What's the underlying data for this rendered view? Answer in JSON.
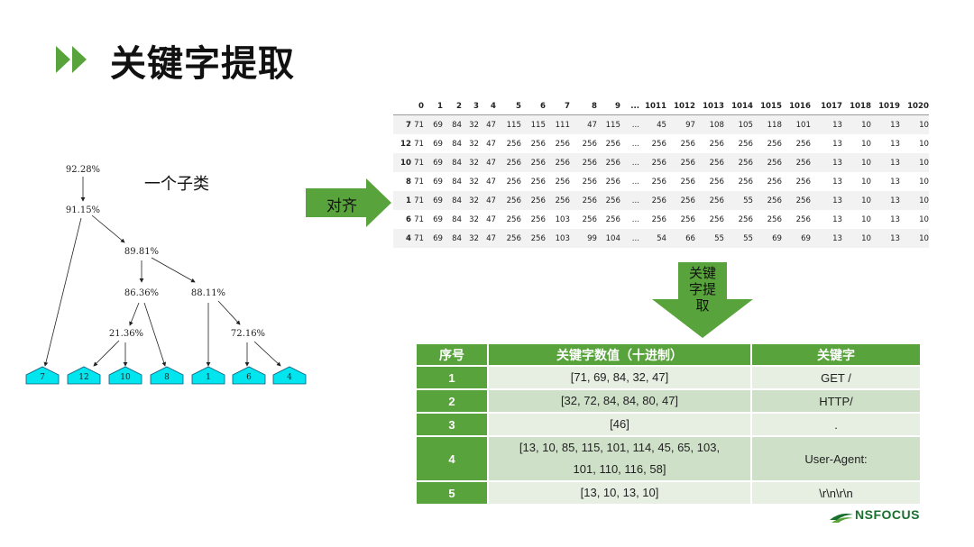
{
  "title": "关键字提取",
  "colors": {
    "accent": "#58a33b",
    "leaf": "#00e5ee",
    "table_header": "#58a33b"
  },
  "tree": {
    "node_labels": [
      "92.28%",
      "91.15%",
      "89.81%",
      "86.36%",
      "88.11%",
      "21.36%",
      "72.16%"
    ],
    "leaf_labels": [
      "7",
      "12",
      "10",
      "8",
      "1",
      "6",
      "4"
    ],
    "cluster_label": "一个子类"
  },
  "align_arrow_label": "对齐",
  "extract_arrow_label": "关键字提取",
  "frame": {
    "columns": [
      "",
      "0",
      "1",
      "2",
      "3",
      "4",
      "5",
      "6",
      "7",
      "8",
      "9",
      "...",
      "1011",
      "1012",
      "1013",
      "1014",
      "1015",
      "1016",
      "1017",
      "1018",
      "1019",
      "1020"
    ],
    "rows": [
      [
        "7",
        "71",
        "69",
        "84",
        "32",
        "47",
        "115",
        "115",
        "111",
        "47",
        "115",
        "...",
        "45",
        "97",
        "108",
        "105",
        "118",
        "101",
        "13",
        "10",
        "13",
        "10"
      ],
      [
        "12",
        "71",
        "69",
        "84",
        "32",
        "47",
        "256",
        "256",
        "256",
        "256",
        "256",
        "...",
        "256",
        "256",
        "256",
        "256",
        "256",
        "256",
        "13",
        "10",
        "13",
        "10"
      ],
      [
        "10",
        "71",
        "69",
        "84",
        "32",
        "47",
        "256",
        "256",
        "256",
        "256",
        "256",
        "...",
        "256",
        "256",
        "256",
        "256",
        "256",
        "256",
        "13",
        "10",
        "13",
        "10"
      ],
      [
        "8",
        "71",
        "69",
        "84",
        "32",
        "47",
        "256",
        "256",
        "256",
        "256",
        "256",
        "...",
        "256",
        "256",
        "256",
        "256",
        "256",
        "256",
        "13",
        "10",
        "13",
        "10"
      ],
      [
        "1",
        "71",
        "69",
        "84",
        "32",
        "47",
        "256",
        "256",
        "256",
        "256",
        "256",
        "...",
        "256",
        "256",
        "256",
        "55",
        "256",
        "256",
        "13",
        "10",
        "13",
        "10"
      ],
      [
        "6",
        "71",
        "69",
        "84",
        "32",
        "47",
        "256",
        "256",
        "103",
        "256",
        "256",
        "...",
        "256",
        "256",
        "256",
        "256",
        "256",
        "256",
        "13",
        "10",
        "13",
        "10"
      ],
      [
        "4",
        "71",
        "69",
        "84",
        "32",
        "47",
        "256",
        "256",
        "103",
        "99",
        "104",
        "...",
        "54",
        "66",
        "55",
        "55",
        "69",
        "69",
        "13",
        "10",
        "13",
        "10"
      ]
    ]
  },
  "keywords_table": {
    "headers": [
      "序号",
      "关键字数值（十进制）",
      "关键字"
    ],
    "rows": [
      {
        "no": "1",
        "values": [
          "[71, 69, 84, 32, 47]"
        ],
        "keyword": "GET /"
      },
      {
        "no": "2",
        "values": [
          "[32, 72, 84, 84, 80, 47]"
        ],
        "keyword": "HTTP/"
      },
      {
        "no": "3",
        "values": [
          "[46]"
        ],
        "keyword": "."
      },
      {
        "no": "4",
        "values": [
          "[13, 10, 85, 115, 101, 114, 45, 65, 103,",
          "101, 110, 116, 58]"
        ],
        "keyword": "User-Agent:"
      },
      {
        "no": "5",
        "values": [
          "[13, 10, 13, 10]"
        ],
        "keyword": "\\r\\n\\r\\n"
      }
    ]
  },
  "logo_text": "NSFOCUS"
}
